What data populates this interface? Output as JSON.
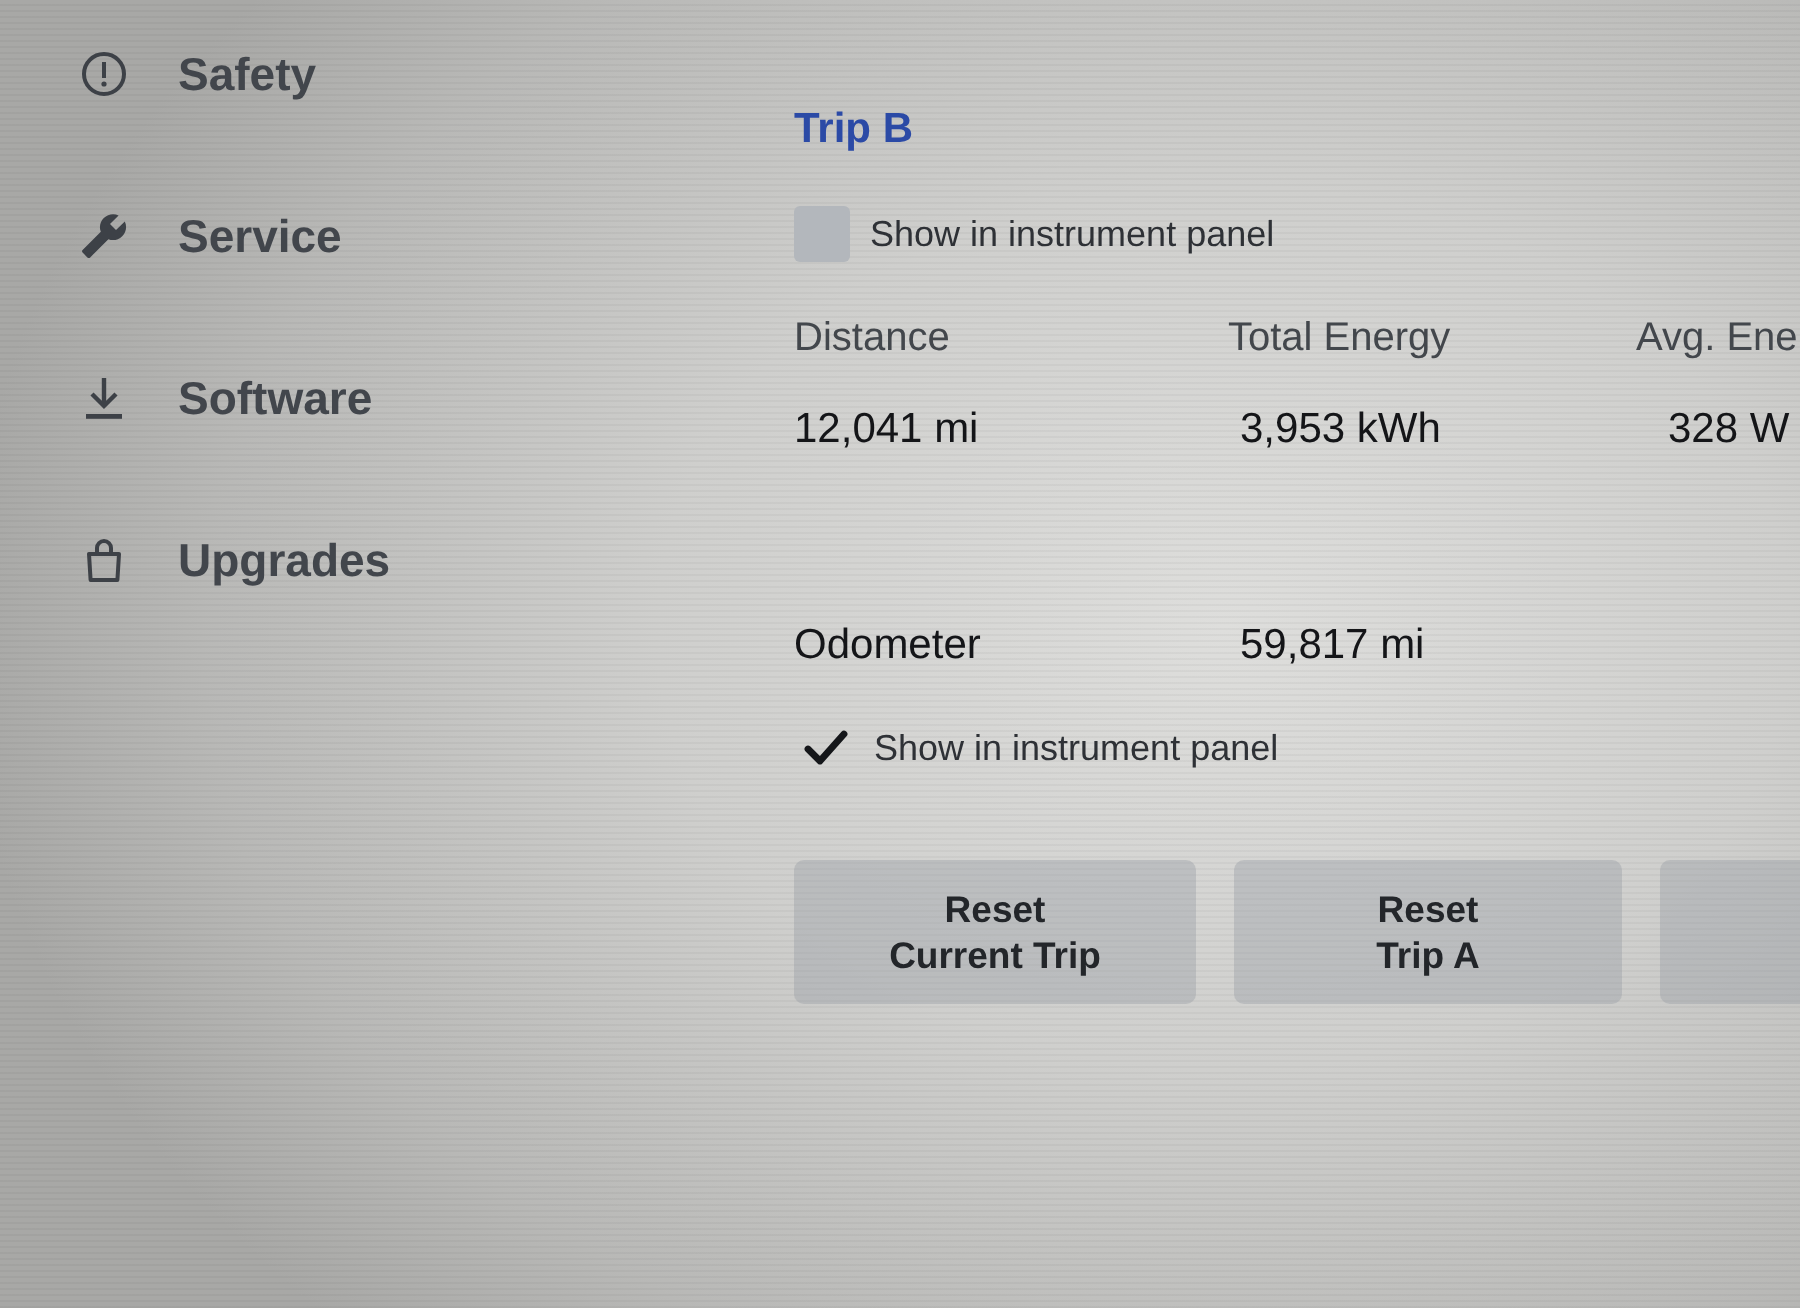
{
  "sidebar": {
    "items": [
      {
        "label": "Safety",
        "selected": false
      },
      {
        "label": "Service",
        "selected": false
      },
      {
        "label": "Software",
        "selected": false
      },
      {
        "label": "Upgrades",
        "selected": false
      }
    ]
  },
  "trip": {
    "title": "Trip B",
    "show_in_instrument_panel": {
      "label": "Show in instrument panel",
      "checked": false
    },
    "stats": [
      {
        "label": "Distance",
        "value": "12,041 mi"
      },
      {
        "label": "Total Energy",
        "value": "3,953 kWh"
      },
      {
        "label": "Avg. Ene",
        "value": "328 W"
      }
    ]
  },
  "odometer": {
    "label": "Odometer",
    "value": "59,817 mi",
    "show_in_instrument_panel": {
      "label": "Show in instrument panel",
      "checked": true
    }
  },
  "buttons": [
    {
      "label": "Reset\nCurrent Trip"
    },
    {
      "label": "Reset\nTrip A"
    }
  ],
  "more_buttons_past_edge": true
}
